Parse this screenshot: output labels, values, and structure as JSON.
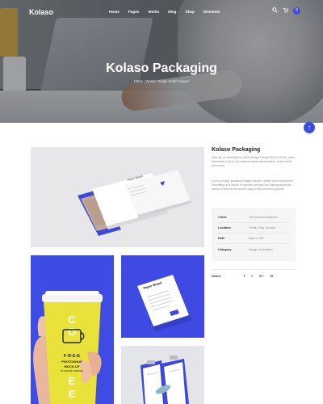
{
  "brand": "Kolaso",
  "nav": {
    "items": [
      "Home",
      "Pages",
      "Works",
      "Blog",
      "Shop",
      "Elements"
    ],
    "icons": [
      "search-icon",
      "cart-icon"
    ],
    "cart_count": "0"
  },
  "hero": {
    "title": "Kolaso Packaging",
    "breadcrumb": "Home / Works / Single Small Images"
  },
  "project": {
    "title": "Kolaso Packaging",
    "description_1": "After all, as described in Web Design Trends 2015 & 2016, vision dominates a lot of our subconscious interpretation of the world around us.",
    "description_2": "On top of that, pleasing images create a better user experience. Rounding up a bunch of specific designs and talking about the merits of each is the perfect way to find common ground.",
    "details": [
      {
        "label": "Client",
        "value": "Themeforest Networks"
      },
      {
        "label": "Location",
        "value": "Tomlin, Stig, Tamalar"
      },
      {
        "label": "Date",
        "value": "May 4, 2017"
      },
      {
        "label": "Category",
        "value": "Design, Illustration"
      }
    ],
    "share_label": "Share",
    "share_icons": [
      "f",
      "t",
      "G+",
      "in"
    ]
  },
  "mockup": {
    "cup_letters": [
      "C",
      "O",
      "F",
      "F",
      "E",
      "E"
    ],
    "cup_text_1": "F·R·E·E",
    "cup_text_2": "PHOTOSHOP",
    "cup_text_3": "MOCK-UP",
    "cup_text_4": "BY GRAPHIC BURGER",
    "letter_brand": "Paper Brand",
    "card_brand": "Paper Brand"
  },
  "colors": {
    "accent": "#3f4ce3",
    "cup_yellow": "#e9e23a"
  }
}
